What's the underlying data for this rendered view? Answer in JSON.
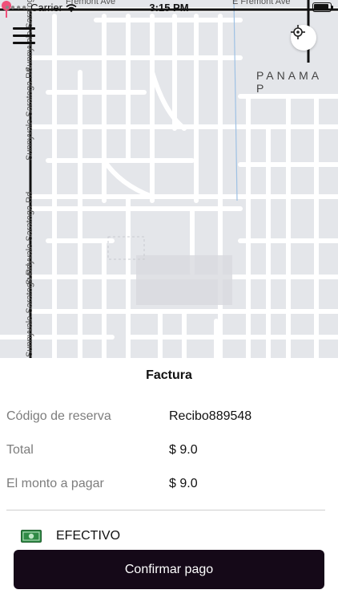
{
  "status_bar": {
    "carrier": "Carrier",
    "time": "3:15 PM"
  },
  "map": {
    "street_vertical": "Sunnyvale Saratoga Rd",
    "street_vertical_partial": "Sunnyvale Saratoga Rd",
    "street_top_left": "Fremont Ave",
    "street_top_right": "E Fremont Ave",
    "area_label": "PANAMA P",
    "icons": {
      "menu": "hamburger-menu-icon",
      "locate": "crosshair-icon",
      "pin": "map-pin-icon"
    },
    "colors": {
      "background": "#e4e6ea",
      "road": "#ffffff",
      "route": "#111111",
      "pin": "#f0507a"
    }
  },
  "invoice": {
    "title": "Factura",
    "rows": [
      {
        "label": "Código de reserva",
        "value": "Recibo889548"
      },
      {
        "label": "Total",
        "value": "$ 9.0"
      },
      {
        "label": "El monto a pagar",
        "value": "$ 9.0"
      }
    ],
    "payment_method": {
      "label": "EFECTIVO",
      "icon": "cash-icon"
    },
    "confirm_button": "Confirmar pago",
    "colors": {
      "button": "#150918",
      "label": "#7d7d7d"
    }
  }
}
